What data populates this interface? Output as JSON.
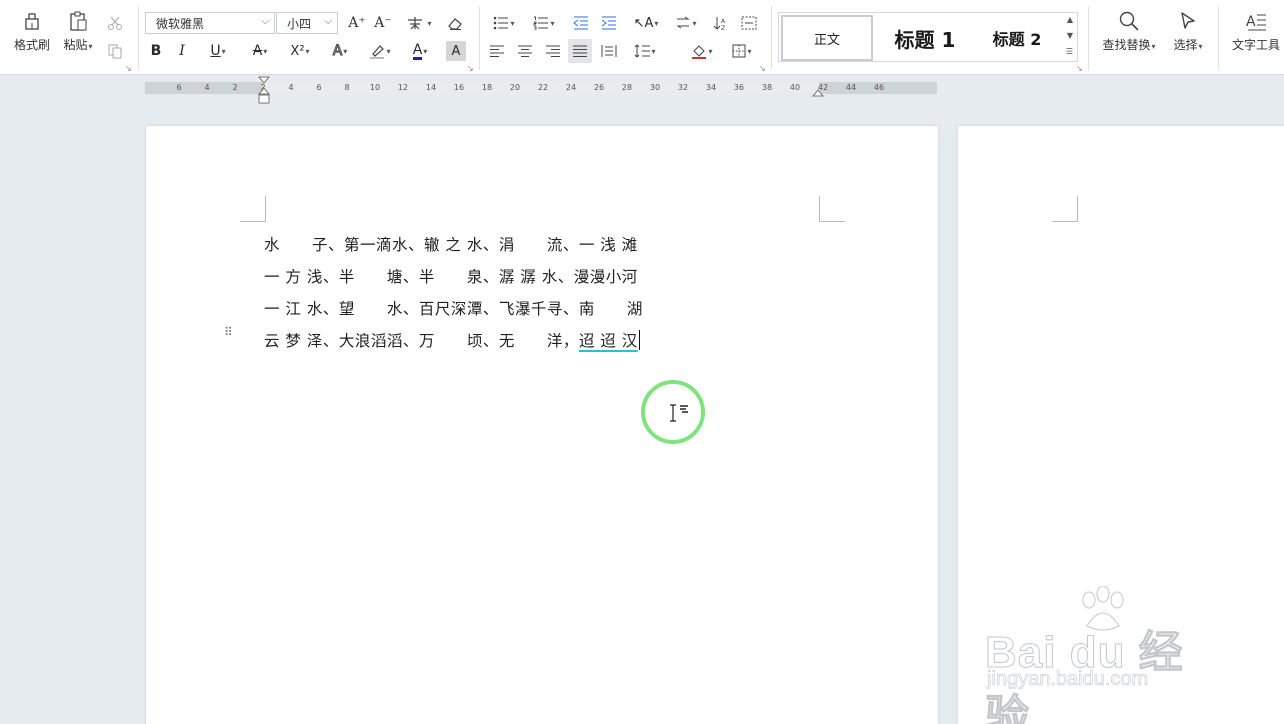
{
  "ribbon": {
    "clipboard": {
      "format_painter": "格式刷",
      "paste": "粘贴"
    },
    "font": {
      "name": "微软雅黑",
      "size": "小四"
    },
    "styles": {
      "normal": "正文",
      "heading1": "标题 1",
      "heading2": "标题 2"
    },
    "find_replace": "查找替换",
    "select": "选择",
    "text_tools": "文字工具"
  },
  "ruler": {
    "ticks": [
      "6",
      "4",
      "2",
      "2",
      "4",
      "6",
      "8",
      "10",
      "12",
      "14",
      "16",
      "18",
      "20",
      "22",
      "24",
      "26",
      "28",
      "30",
      "32",
      "34",
      "36",
      "38",
      "40",
      "42",
      "44",
      "46"
    ]
  },
  "document": {
    "lines": [
      "水　　子、第一滴水、辙 之 水、涓　　流、一 浅 滩",
      "一 方 浅、半　　塘、半　　泉、潺 潺 水、漫漫小河",
      "一 江 水、望　　水、百尺深潭、飞瀑千寻、南　　湖",
      "云 梦 泽、大浪滔滔、万　　顷、无　　洋，"
    ],
    "last_word": "迢 迢 汉"
  },
  "watermark": {
    "brand": "Bai du 经验",
    "url": "jingyan.baidu.com"
  },
  "colors": {
    "accent_cursor_ring": "#7fe37e",
    "spell_underline": "#27c1d3"
  }
}
